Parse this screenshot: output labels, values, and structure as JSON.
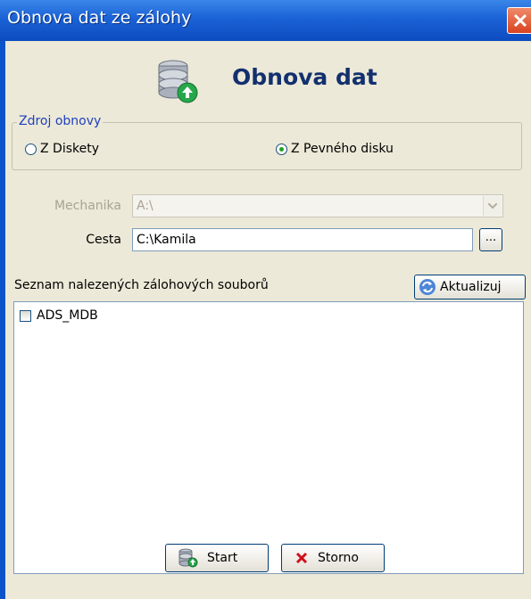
{
  "window": {
    "title": "Obnova dat ze zálohy"
  },
  "header": {
    "title": "Obnova dat",
    "icon": "database-restore-icon"
  },
  "source_group": {
    "legend": "Zdroj obnovy",
    "options": [
      {
        "label": "Z Diskety",
        "selected": false
      },
      {
        "label": "Z Pevného disku",
        "selected": true
      }
    ]
  },
  "drive": {
    "label": "Mechanika",
    "value": "A:\\",
    "disabled": true
  },
  "path": {
    "label": "Cesta",
    "value": "C:\\Kamila",
    "browse_label": "..."
  },
  "backup_list": {
    "label": "Seznam nalezených zálohových souborů",
    "refresh_label": "Aktualizuj",
    "items": [
      {
        "name": "ADS_MDB",
        "checked": false
      }
    ]
  },
  "buttons": {
    "start_label": "Start",
    "cancel_label": "Storno"
  },
  "colors": {
    "title_bar": "#1a62d6",
    "background": "#ece9d8",
    "header_title": "#13306e",
    "group_legend": "#1f3fbe",
    "cancel_x": "#d0101a"
  }
}
